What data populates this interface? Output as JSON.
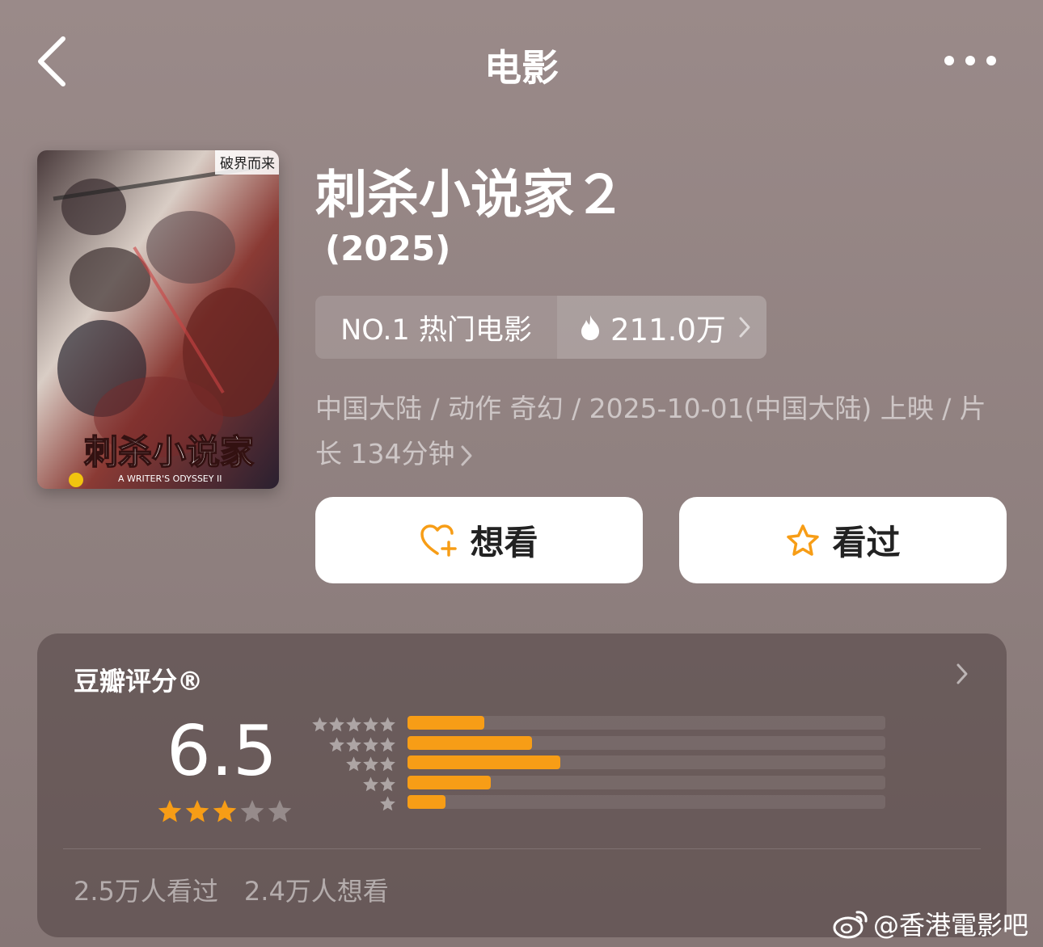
{
  "nav": {
    "title": "电影"
  },
  "movie": {
    "title": "刺杀小说家２",
    "year": "(2025)",
    "poster": {
      "top_text": "破界而来",
      "title_text": "刺杀小说家",
      "subtitle_text": "A WRITER'S ODYSSEY II"
    },
    "rank_label": "NO.1 热门电影",
    "heat": "211.0万",
    "meta": "中国大陆 / 动作 奇幻 / 2025-10-01(中国大陆) 上映 / 片长 134分钟"
  },
  "actions": {
    "want": "想看",
    "seen": "看过"
  },
  "rating": {
    "title": "豆瓣评分®",
    "score": "6.5",
    "stars": 3,
    "distribution": [
      {
        "stars": 5,
        "percent": 16
      },
      {
        "stars": 4,
        "percent": 26
      },
      {
        "stars": 3,
        "percent": 32
      },
      {
        "stars": 2,
        "percent": 17.5
      },
      {
        "stars": 1,
        "percent": 8
      }
    ],
    "seen_count": "2.5万人看过",
    "want_count": "2.4万人想看"
  },
  "watermark": "@香港電影吧",
  "colors": {
    "accent": "#f79d16",
    "background": "#938483"
  }
}
